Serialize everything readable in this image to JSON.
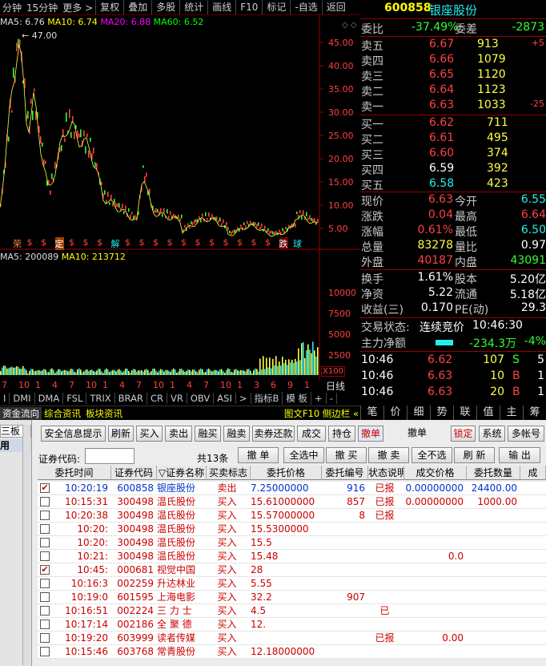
{
  "chart_toolbar": {
    "periods": [
      "分钟",
      "15分钟",
      "更多 >"
    ],
    "buttons": [
      "复权",
      "叠加",
      "多股",
      "统计",
      "画线",
      "F10",
      "标记",
      "-自选",
      "返回"
    ]
  },
  "price_chart": {
    "legend": {
      "ma5": "MA5: 6.76",
      "ma10": "MA10: 6.74",
      "ma20": "MA20: 6.88",
      "ma60": "MA60: 6.52"
    },
    "peak_label": "47.00",
    "axis_ticks": [
      "45.00",
      "40.00",
      "35.00",
      "30.00",
      "25.00",
      "20.00",
      "15.00",
      "10.00",
      "5.00"
    ],
    "markers": [
      "荣",
      "$",
      "$",
      "定",
      "$",
      "$",
      "$",
      "解",
      "$",
      "$",
      "$",
      "$",
      "$",
      "$",
      "$",
      "$",
      "$",
      "$",
      "$",
      "跌",
      "球"
    ]
  },
  "volume_chart": {
    "legend": {
      "ma5": "MA5: 200089",
      "ma10": "MA10: 213712"
    },
    "axis_ticks": [
      "10000",
      "7500",
      "5000",
      "2500"
    ],
    "unit": "X100"
  },
  "time_axis": [
    "7",
    "10",
    "1",
    "4",
    "7",
    "10",
    "1",
    "4",
    "7",
    "10",
    "1",
    "4",
    "7",
    "10",
    "1",
    "3",
    "6",
    "9",
    "1"
  ],
  "time_axis_label": "日线",
  "indicator_tabs": [
    "I",
    "DMI",
    "DMA",
    "FSL",
    "TRIX",
    "BRAR",
    "CR",
    "VR",
    "OBV",
    "ASI",
    ">",
    "指标B",
    "模 板",
    "+",
    "-"
  ],
  "info_tabs": [
    "资金流向",
    "综合资讯",
    "板块资讯"
  ],
  "info_right": "图文F10 侧边栏 «",
  "quote": {
    "code": "600858",
    "name": "银座股份",
    "webi_label": "委比",
    "webi": "-37.49%",
    "weicha_label": "委差",
    "weicha": "-2873",
    "sells": [
      {
        "label": "卖五",
        "price": "6.67",
        "vol": "913",
        "chg": "+5"
      },
      {
        "label": "卖四",
        "price": "6.66",
        "vol": "1079",
        "chg": ""
      },
      {
        "label": "卖三",
        "price": "6.65",
        "vol": "1120",
        "chg": ""
      },
      {
        "label": "卖二",
        "price": "6.64",
        "vol": "1123",
        "chg": ""
      },
      {
        "label": "卖一",
        "price": "6.63",
        "vol": "1033",
        "chg": "-25"
      }
    ],
    "buys": [
      {
        "label": "买一",
        "price": "6.62",
        "vol": "711"
      },
      {
        "label": "买二",
        "price": "6.61",
        "vol": "495"
      },
      {
        "label": "买三",
        "price": "6.60",
        "vol": "374"
      },
      {
        "label": "买四",
        "price": "6.59",
        "vol": "392"
      },
      {
        "label": "买五",
        "price": "6.58",
        "vol": "423"
      }
    ],
    "stats": [
      {
        "l1": "现价",
        "v1": "6.63",
        "l2": "今开",
        "v2": "6.55"
      },
      {
        "l1": "涨跌",
        "v1": "0.04",
        "l2": "最高",
        "v2": "6.64"
      },
      {
        "l1": "涨幅",
        "v1": "0.61%",
        "l2": "最低",
        "v2": "6.50"
      },
      {
        "l1": "总量",
        "v1": "83278",
        "l2": "量比",
        "v2": "0.97"
      },
      {
        "l1": "外盘",
        "v1": "40187",
        "l2": "内盘",
        "v2": "43091"
      }
    ],
    "stats2": [
      {
        "l1": "换手",
        "v1": "1.61%",
        "l2": "股本",
        "v2": "5.20亿"
      },
      {
        "l1": "净资",
        "v1": "5.22",
        "l2": "流通",
        "v2": "5.18亿"
      },
      {
        "l1": "收益(三)",
        "v1": "0.170",
        "l2": "PE(动)",
        "v2": "29.3"
      }
    ],
    "trade_state_label": "交易状态:",
    "trade_state": "连续竞价",
    "trade_time": "10:46:30",
    "main_flow_label": "主力净额",
    "main_flow": "-234.3万",
    "main_flow_pct": "-4%",
    "ticks": [
      {
        "time": "10:46",
        "price": "6.62",
        "vol": "107",
        "dir": "S",
        "n": "5"
      },
      {
        "time": "10:46",
        "price": "6.63",
        "vol": "10",
        "dir": "B",
        "n": "1"
      },
      {
        "time": "10:46",
        "price": "6.63",
        "vol": "20",
        "dir": "B",
        "n": "1"
      }
    ],
    "tabs": [
      "笔",
      "价",
      "细",
      "势",
      "联",
      "值",
      "主",
      "筹"
    ]
  },
  "trade_panel": {
    "nav_items": [
      "三板",
      "用"
    ],
    "buttons1": [
      "安全信息提示",
      "刷新",
      "买入",
      "卖出",
      "融买",
      "融卖",
      "卖券还款",
      "成交",
      "持仓",
      "撤单",
      "撤单",
      "锁定",
      "系统",
      "多帐号"
    ],
    "code_label": "证券代码:",
    "total": "共13条",
    "buttons2": [
      "撤 单",
      "全选中",
      "撤 买",
      "撤 卖",
      "全不选",
      "刷 新",
      "输 出"
    ],
    "columns": [
      "委托时间",
      "证券代码",
      "▽证券名称",
      "买卖标志",
      "委托价格",
      "委托编号",
      "状态说明",
      "成交价格",
      "委托数量",
      "成"
    ],
    "rows": [
      {
        "checked": true,
        "time": "10:20:19",
        "code": "600858",
        "name": "银座股份",
        "side": "卖出",
        "price": "7.25000000",
        "no": "916",
        "status": "已报",
        "deal": "0.00000000",
        "qty": "24400.00"
      },
      {
        "checked": false,
        "time": "10:15:31",
        "code": "300498",
        "name": "温氏股份",
        "side": "买入",
        "price": "15.61000000",
        "no": "857",
        "status": "已报",
        "deal": "0.00000000",
        "qty": "1000.00"
      },
      {
        "checked": false,
        "time": "10:20:38",
        "code": "300498",
        "name": "温氏股份",
        "side": "买入",
        "price": "15.57000000",
        "no": "8",
        "status": "已报",
        "deal": "",
        "qty": ""
      },
      {
        "checked": false,
        "time": "10:20:",
        "code": "300498",
        "name": "温氏股份",
        "side": "买入",
        "price": "15.5300000",
        "no": "",
        "status": "",
        "deal": "",
        "qty": ""
      },
      {
        "checked": false,
        "time": "10:20:",
        "code": "300498",
        "name": "温氏股份",
        "side": "买入",
        "price": "15.5",
        "no": "",
        "status": "",
        "deal": "",
        "qty": ""
      },
      {
        "checked": false,
        "time": "10:21:",
        "code": "300498",
        "name": "温氏股份",
        "side": "买入",
        "price": "15.48",
        "no": "",
        "status": "",
        "deal": "0.0",
        "qty": ""
      },
      {
        "checked": true,
        "time": "10:45:",
        "code": "000681",
        "name": "视觉中国",
        "side": "买入",
        "price": "28",
        "no": "",
        "status": "",
        "deal": "",
        "qty": ""
      },
      {
        "checked": false,
        "time": "10:16:3",
        "code": "002259",
        "name": "升达林业",
        "side": "买入",
        "price": "5.55",
        "no": "",
        "status": "",
        "deal": "",
        "qty": ""
      },
      {
        "checked": false,
        "time": "10:19:0",
        "code": "601595",
        "name": "上海电影",
        "side": "买入",
        "price": "32.2",
        "no": "907",
        "status": "",
        "deal": "",
        "qty": ""
      },
      {
        "checked": false,
        "time": "10:16:51",
        "code": "002224",
        "name": "三 力 士",
        "side": "买入",
        "price": "4.5",
        "no": "",
        "status": "已",
        "deal": "",
        "qty": ""
      },
      {
        "checked": false,
        "time": "10:17:14",
        "code": "002186",
        "name": "全 聚 德",
        "side": "买入",
        "price": "12.",
        "no": "",
        "status": "",
        "deal": "",
        "qty": ""
      },
      {
        "checked": false,
        "time": "10:19:20",
        "code": "603999",
        "name": "读者传媒",
        "side": "买入",
        "price": "",
        "no": "",
        "status": "已报",
        "deal": "0.00",
        "qty": ""
      },
      {
        "checked": false,
        "time": "10:15:46",
        "code": "603768",
        "name": "常青股份",
        "side": "买入",
        "price": "12.18000000",
        "no": "",
        "status": "",
        "deal": "",
        "qty": ""
      }
    ]
  },
  "colors": {
    "up": "#ff4040",
    "down": "#30ff30",
    "price_line": "#ffff44",
    "border": "#900000"
  }
}
